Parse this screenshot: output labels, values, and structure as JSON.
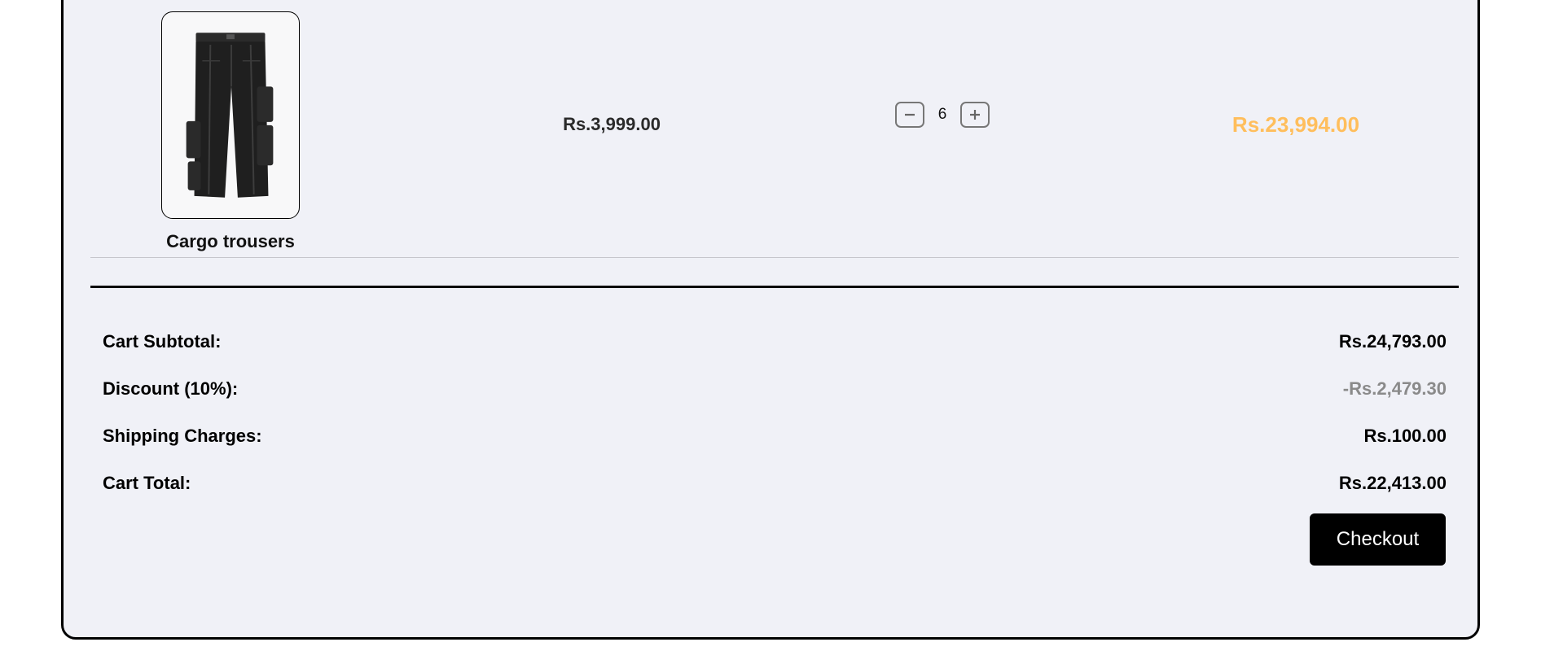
{
  "cart": {
    "items": [
      {
        "name": "Cargo trousers",
        "unit_price": "Rs.3,999.00",
        "quantity": "6",
        "line_total": "Rs.23,994.00",
        "image_icon": "cargo-trousers-image"
      }
    ],
    "qty_icons": {
      "decrease": "minus-icon",
      "increase": "plus-icon"
    }
  },
  "summary": {
    "subtotal_label": "Cart Subtotal:",
    "subtotal_value": "Rs.24,793.00",
    "discount_label": "Discount (10%):",
    "discount_value": "-Rs.2,479.30",
    "shipping_label": "Shipping Charges:",
    "shipping_value": "Rs.100.00",
    "total_label": "Cart Total:",
    "total_value": "Rs.22,413.00",
    "checkout_label": "Checkout"
  },
  "colors": {
    "panel_bg": "#f0f1f7",
    "line_total": "#ffbe5c",
    "discount": "#8a8a8a",
    "button_bg": "#000000"
  }
}
